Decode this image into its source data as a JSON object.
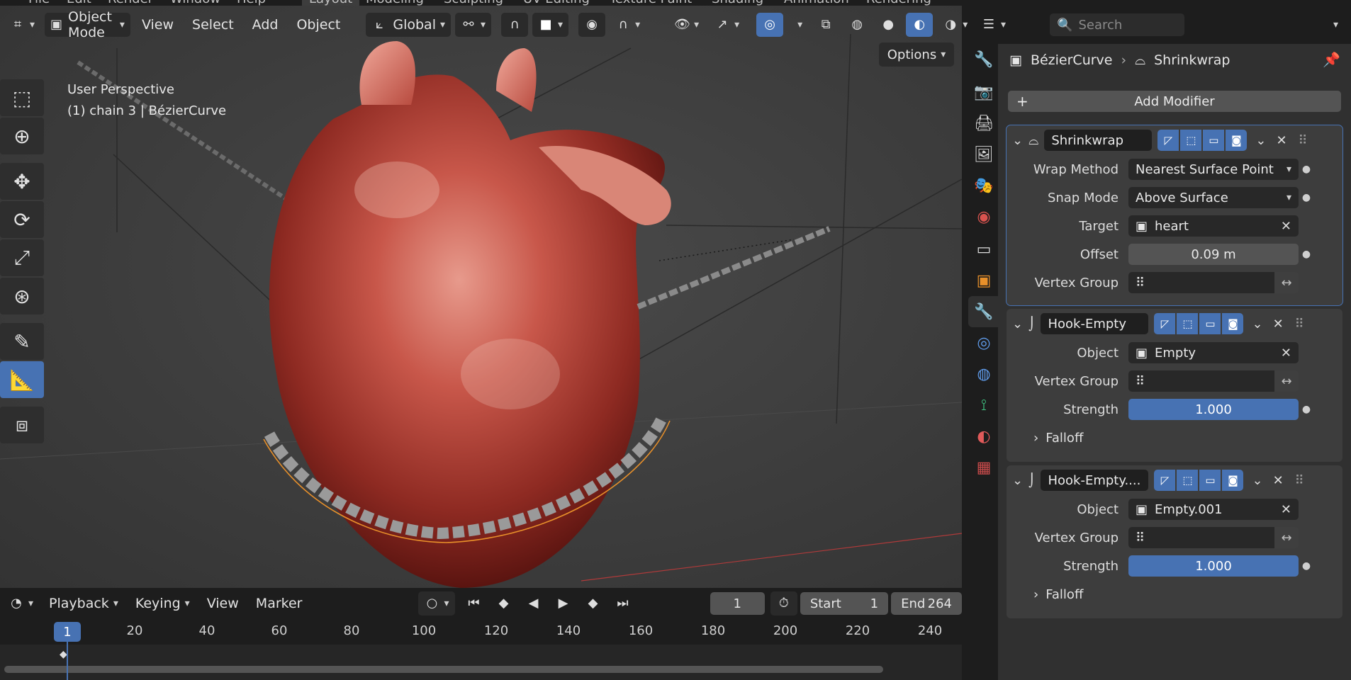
{
  "workspace_tabs": [
    "File",
    "Edit",
    "Render",
    "Window",
    "Help",
    "Layout",
    "Modeling",
    "Sculpting",
    "UV Editing",
    "Texture Paint",
    "Shading",
    "Animation",
    "Rendering"
  ],
  "viewport": {
    "mode_label": "Object Mode",
    "menus": [
      "View",
      "Select",
      "Add",
      "Object"
    ],
    "transform_orientation": "Global",
    "perspective_label": "User Perspective",
    "object_label": "(1) chain 3 | BézierCurve",
    "options_label": "Options"
  },
  "toolbar": {
    "tools": [
      "select-box",
      "cursor",
      "move",
      "rotate",
      "scale",
      "transform",
      "annotate",
      "measure",
      "add-cube"
    ],
    "active_tool": "measure"
  },
  "timeline": {
    "menus": [
      "Playback",
      "Keying",
      "View",
      "Marker"
    ],
    "current_frame": "1",
    "start_label": "Start",
    "start_value": "1",
    "end_label": "End",
    "end_value": "264",
    "ruler_marks": [
      "1",
      "20",
      "40",
      "60",
      "80",
      "100",
      "120",
      "140",
      "160",
      "180",
      "200",
      "220",
      "240"
    ]
  },
  "properties": {
    "search_placeholder": "Search",
    "breadcrumb": {
      "object": "BézierCurve",
      "modifier": "Shrinkwrap"
    },
    "add_modifier_label": "Add Modifier",
    "modifiers": [
      {
        "name": "Shrinkwrap",
        "rows": [
          {
            "label": "Wrap Method",
            "value": "Nearest Surface Point"
          },
          {
            "label": "Snap Mode",
            "value": "Above Surface"
          },
          {
            "label": "Target",
            "value": "heart"
          },
          {
            "label": "Offset",
            "value": "0.09 m"
          },
          {
            "label": "Vertex Group",
            "value": ""
          }
        ]
      },
      {
        "name": "Hook-Empty",
        "rows": [
          {
            "label": "Object",
            "value": "Empty"
          },
          {
            "label": "Vertex Group",
            "value": ""
          },
          {
            "label": "Strength",
            "value": "1.000"
          }
        ],
        "falloff_label": "Falloff"
      },
      {
        "name": "Hook-Empty....",
        "rows": [
          {
            "label": "Object",
            "value": "Empty.001"
          },
          {
            "label": "Vertex Group",
            "value": ""
          },
          {
            "label": "Strength",
            "value": "1.000"
          }
        ],
        "falloff_label": "Falloff"
      }
    ]
  },
  "colors": {
    "accent": "#4772b3",
    "panel": "#303030",
    "viewport_bg": "#3d3d3d",
    "selection_outline": "#e8902a"
  }
}
